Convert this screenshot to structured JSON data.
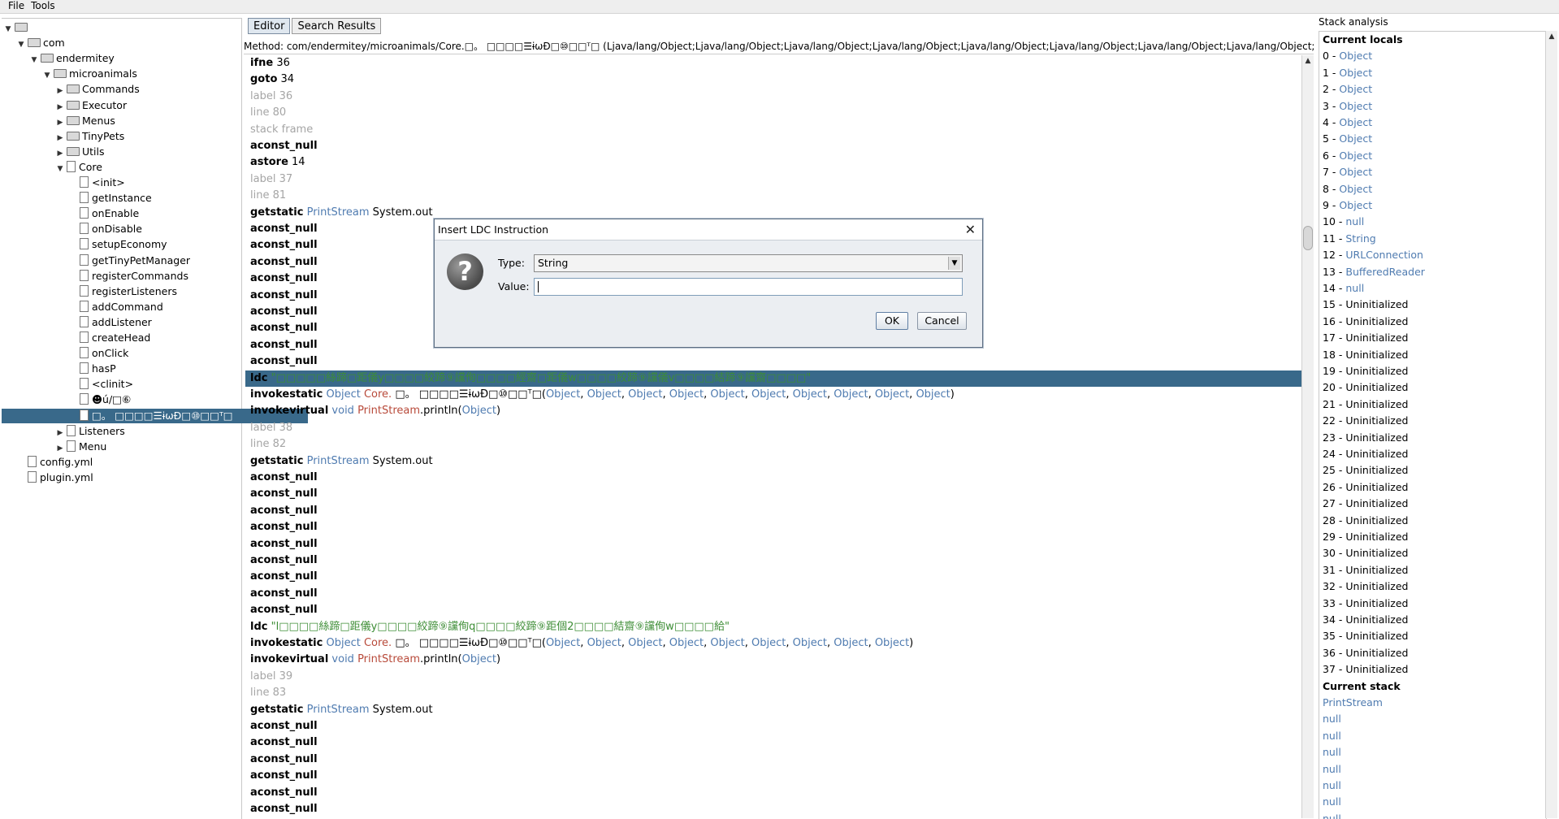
{
  "menu": [
    "File",
    "Tools"
  ],
  "tree": [
    {
      "label": "",
      "depth": 0,
      "kind": "folder",
      "expanded": true
    },
    {
      "label": "com",
      "depth": 1,
      "kind": "folder",
      "expanded": true
    },
    {
      "label": "endermitey",
      "depth": 2,
      "kind": "folder",
      "expanded": true
    },
    {
      "label": "microanimals",
      "depth": 3,
      "kind": "folder",
      "expanded": true
    },
    {
      "label": "Commands",
      "depth": 4,
      "kind": "folder",
      "expanded": false
    },
    {
      "label": "Executor",
      "depth": 4,
      "kind": "folder",
      "expanded": false
    },
    {
      "label": "Menus",
      "depth": 4,
      "kind": "folder",
      "expanded": false
    },
    {
      "label": "TinyPets",
      "depth": 4,
      "kind": "folder",
      "expanded": false
    },
    {
      "label": "Utils",
      "depth": 4,
      "kind": "folder",
      "expanded": false
    },
    {
      "label": "Core",
      "depth": 4,
      "kind": "file",
      "expanded": true
    },
    {
      "label": "<init>",
      "depth": 5,
      "kind": "file"
    },
    {
      "label": "getInstance",
      "depth": 5,
      "kind": "file"
    },
    {
      "label": "onEnable",
      "depth": 5,
      "kind": "file"
    },
    {
      "label": "onDisable",
      "depth": 5,
      "kind": "file"
    },
    {
      "label": "setupEconomy",
      "depth": 5,
      "kind": "file"
    },
    {
      "label": "getTinyPetManager",
      "depth": 5,
      "kind": "file"
    },
    {
      "label": "registerCommands",
      "depth": 5,
      "kind": "file"
    },
    {
      "label": "registerListeners",
      "depth": 5,
      "kind": "file"
    },
    {
      "label": "addCommand",
      "depth": 5,
      "kind": "file"
    },
    {
      "label": "addListener",
      "depth": 5,
      "kind": "file"
    },
    {
      "label": "createHead",
      "depth": 5,
      "kind": "file"
    },
    {
      "label": "onClick",
      "depth": 5,
      "kind": "file"
    },
    {
      "label": "hasP",
      "depth": 5,
      "kind": "file"
    },
    {
      "label": "<clinit>",
      "depth": 5,
      "kind": "file"
    },
    {
      "label": "☻ú/□⑥",
      "depth": 5,
      "kind": "file"
    },
    {
      "label": "□。  □□□□☰ɨωĐ□⑩□□ᵀ□",
      "depth": 5,
      "kind": "file",
      "selected": true
    },
    {
      "label": "Listeners",
      "depth": 4,
      "kind": "file",
      "expanded": false
    },
    {
      "label": "Menu",
      "depth": 4,
      "kind": "file",
      "expanded": false
    },
    {
      "label": "config.yml",
      "depth": 1,
      "kind": "file"
    },
    {
      "label": "plugin.yml",
      "depth": 1,
      "kind": "file"
    }
  ],
  "tabs": [
    "Editor",
    "Search Results"
  ],
  "method_signature": "Method: com/endermitey/microanimals/Core.□。  □□□□☰ɨωĐ□⑩□□ᵀ□ (Ljava/lang/Object;Ljava/lang/Object;Ljava/lang/Object;Ljava/lang/Object;Ljava/lang/Object;Ljava/lang/Object;Ljava/lang/Object;Ljava/lang/Object;Ljava/lang/Object;Ljav...",
  "code_lines": [
    {
      "parts": [
        [
          "op",
          "ifne"
        ],
        [
          "",
          "36"
        ]
      ]
    },
    {
      "parts": [
        [
          "op",
          "goto"
        ],
        [
          "",
          "34"
        ]
      ]
    },
    {
      "parts": [
        [
          "gray",
          "label 36"
        ]
      ]
    },
    {
      "parts": [
        [
          "gray",
          "line 80"
        ]
      ]
    },
    {
      "parts": [
        [
          "gray",
          "stack frame"
        ]
      ]
    },
    {
      "parts": [
        [
          "op",
          "aconst_null"
        ]
      ]
    },
    {
      "parts": [
        [
          "op",
          "astore"
        ],
        [
          "",
          "14"
        ]
      ]
    },
    {
      "parts": [
        [
          "gray",
          "label 37"
        ]
      ]
    },
    {
      "parts": [
        [
          "gray",
          "line 81"
        ]
      ]
    },
    {
      "parts": [
        [
          "op",
          "getstatic"
        ],
        [
          "blue",
          "PrintStream"
        ],
        [
          "",
          " System.out"
        ]
      ]
    },
    {
      "parts": [
        [
          "op",
          "aconst_null"
        ]
      ]
    },
    {
      "parts": [
        [
          "op",
          "aconst_null"
        ]
      ]
    },
    {
      "parts": [
        [
          "op",
          "aconst_null"
        ]
      ]
    },
    {
      "parts": [
        [
          "op",
          "aconst_null"
        ]
      ]
    },
    {
      "parts": [
        [
          "op",
          "aconst_null"
        ]
      ]
    },
    {
      "parts": [
        [
          "op",
          "aconst_null"
        ]
      ]
    },
    {
      "parts": [
        [
          "op",
          "aconst_null"
        ]
      ]
    },
    {
      "parts": [
        [
          "op",
          "aconst_null"
        ]
      ]
    },
    {
      "parts": [
        [
          "op",
          "aconst_null"
        ]
      ]
    },
    {
      "selected": true,
      "parts": [
        [
          "op",
          "ldc"
        ],
        [
          "green",
          "\"□□□□□絲蹄□距儀y□□□□絞蹄⑨讜侚□□□□經齋□距儀w□□□□絞蹄⑨讜儀v□□□□結蹄⑨讜齋□□□□\""
        ]
      ]
    },
    {
      "parts": [
        [
          "op",
          "invokestatic"
        ],
        [
          "blue",
          "Object"
        ],
        [
          "red",
          " Core."
        ],
        [
          "",
          " □。  □□□□☰ɨωĐ□⑩□□ᵀ□("
        ],
        [
          "blue",
          "Object"
        ],
        [
          "",
          ", "
        ],
        [
          "blue",
          "Object"
        ],
        [
          "",
          ", "
        ],
        [
          "blue",
          "Object"
        ],
        [
          "",
          ", "
        ],
        [
          "blue",
          "Object"
        ],
        [
          "",
          ", "
        ],
        [
          "blue",
          "Object"
        ],
        [
          "",
          ", "
        ],
        [
          "blue",
          "Object"
        ],
        [
          "",
          ", "
        ],
        [
          "blue",
          "Object"
        ],
        [
          "",
          ", "
        ],
        [
          "blue",
          "Object"
        ],
        [
          "",
          ", "
        ],
        [
          "blue",
          "Object"
        ],
        [
          "",
          ", "
        ],
        [
          "blue",
          "Object"
        ],
        [
          "",
          ")"
        ]
      ]
    },
    {
      "parts": [
        [
          "op",
          "invokevirtual"
        ],
        [
          "blue",
          "void"
        ],
        [
          "red",
          " PrintStream"
        ],
        [
          "",
          ".println("
        ],
        [
          "blue",
          "Object"
        ],
        [
          "",
          ")"
        ]
      ]
    },
    {
      "parts": [
        [
          "gray",
          "label 38"
        ]
      ]
    },
    {
      "parts": [
        [
          "gray",
          "line 82"
        ]
      ]
    },
    {
      "parts": [
        [
          "op",
          "getstatic"
        ],
        [
          "blue",
          "PrintStream"
        ],
        [
          "",
          " System.out"
        ]
      ]
    },
    {
      "parts": [
        [
          "op",
          "aconst_null"
        ]
      ]
    },
    {
      "parts": [
        [
          "op",
          "aconst_null"
        ]
      ]
    },
    {
      "parts": [
        [
          "op",
          "aconst_null"
        ]
      ]
    },
    {
      "parts": [
        [
          "op",
          "aconst_null"
        ]
      ]
    },
    {
      "parts": [
        [
          "op",
          "aconst_null"
        ]
      ]
    },
    {
      "parts": [
        [
          "op",
          "aconst_null"
        ]
      ]
    },
    {
      "parts": [
        [
          "op",
          "aconst_null"
        ]
      ]
    },
    {
      "parts": [
        [
          "op",
          "aconst_null"
        ]
      ]
    },
    {
      "parts": [
        [
          "op",
          "aconst_null"
        ]
      ]
    },
    {
      "parts": [
        [
          "op",
          "ldc"
        ],
        [
          "green",
          "\"l□□□□絲蹄□距儀y□□□□絞蹄⑨讜侚q□□□□絞蹄⑨距個2□□□□結齋⑨讜侚w□□□□給\""
        ]
      ]
    },
    {
      "parts": [
        [
          "op",
          "invokestatic"
        ],
        [
          "blue",
          "Object"
        ],
        [
          "red",
          " Core."
        ],
        [
          "",
          " □。  □□□□☰ɨωĐ□⑩□□ᵀ□("
        ],
        [
          "blue",
          "Object"
        ],
        [
          "",
          ", "
        ],
        [
          "blue",
          "Object"
        ],
        [
          "",
          ", "
        ],
        [
          "blue",
          "Object"
        ],
        [
          "",
          ", "
        ],
        [
          "blue",
          "Object"
        ],
        [
          "",
          ", "
        ],
        [
          "blue",
          "Object"
        ],
        [
          "",
          ", "
        ],
        [
          "blue",
          "Object"
        ],
        [
          "",
          ", "
        ],
        [
          "blue",
          "Object"
        ],
        [
          "",
          ", "
        ],
        [
          "blue",
          "Object"
        ],
        [
          "",
          ", "
        ],
        [
          "blue",
          "Object"
        ],
        [
          "",
          ")"
        ]
      ]
    },
    {
      "parts": [
        [
          "op",
          "invokevirtual"
        ],
        [
          "blue",
          "void"
        ],
        [
          "red",
          " PrintStream"
        ],
        [
          "",
          ".println("
        ],
        [
          "blue",
          "Object"
        ],
        [
          "",
          ")"
        ]
      ]
    },
    {
      "parts": [
        [
          "gray",
          "label 39"
        ]
      ]
    },
    {
      "parts": [
        [
          "gray",
          "line 83"
        ]
      ]
    },
    {
      "parts": [
        [
          "op",
          "getstatic"
        ],
        [
          "blue",
          "PrintStream"
        ],
        [
          "",
          " System.out"
        ]
      ]
    },
    {
      "parts": [
        [
          "op",
          "aconst_null"
        ]
      ]
    },
    {
      "parts": [
        [
          "op",
          "aconst_null"
        ]
      ]
    },
    {
      "parts": [
        [
          "op",
          "aconst_null"
        ]
      ]
    },
    {
      "parts": [
        [
          "op",
          "aconst_null"
        ]
      ]
    },
    {
      "parts": [
        [
          "op",
          "aconst_null"
        ]
      ]
    },
    {
      "parts": [
        [
          "op",
          "aconst_null"
        ]
      ]
    },
    {
      "parts": [
        [
          "op",
          "aconst_null"
        ]
      ]
    }
  ],
  "stack_analysis": {
    "title": "Stack analysis",
    "locals_header": "Current locals",
    "locals": [
      [
        "0",
        "Object",
        "blue"
      ],
      [
        "1",
        "Object",
        "blue"
      ],
      [
        "2",
        "Object",
        "blue"
      ],
      [
        "3",
        "Object",
        "blue"
      ],
      [
        "4",
        "Object",
        "blue"
      ],
      [
        "5",
        "Object",
        "blue"
      ],
      [
        "6",
        "Object",
        "blue"
      ],
      [
        "7",
        "Object",
        "blue"
      ],
      [
        "8",
        "Object",
        "blue"
      ],
      [
        "9",
        "Object",
        "blue"
      ],
      [
        "10",
        "null",
        "blue"
      ],
      [
        "11",
        "String",
        "blue"
      ],
      [
        "12",
        "URLConnection",
        "blue"
      ],
      [
        "13",
        "BufferedReader",
        "blue"
      ],
      [
        "14",
        "null",
        "blue"
      ],
      [
        "15",
        "Uninitialized",
        ""
      ],
      [
        "16",
        "Uninitialized",
        ""
      ],
      [
        "17",
        "Uninitialized",
        ""
      ],
      [
        "18",
        "Uninitialized",
        ""
      ],
      [
        "19",
        "Uninitialized",
        ""
      ],
      [
        "20",
        "Uninitialized",
        ""
      ],
      [
        "21",
        "Uninitialized",
        ""
      ],
      [
        "22",
        "Uninitialized",
        ""
      ],
      [
        "23",
        "Uninitialized",
        ""
      ],
      [
        "24",
        "Uninitialized",
        ""
      ],
      [
        "25",
        "Uninitialized",
        ""
      ],
      [
        "26",
        "Uninitialized",
        ""
      ],
      [
        "27",
        "Uninitialized",
        ""
      ],
      [
        "28",
        "Uninitialized",
        ""
      ],
      [
        "29",
        "Uninitialized",
        ""
      ],
      [
        "30",
        "Uninitialized",
        ""
      ],
      [
        "31",
        "Uninitialized",
        ""
      ],
      [
        "32",
        "Uninitialized",
        ""
      ],
      [
        "33",
        "Uninitialized",
        ""
      ],
      [
        "34",
        "Uninitialized",
        ""
      ],
      [
        "35",
        "Uninitialized",
        ""
      ],
      [
        "36",
        "Uninitialized",
        ""
      ],
      [
        "37",
        "Uninitialized",
        ""
      ]
    ],
    "stack_header": "Current stack",
    "stack": [
      "PrintStream",
      "null",
      "null",
      "null",
      "null",
      "null",
      "null",
      "null"
    ]
  },
  "dialog": {
    "title": "Insert LDC Instruction",
    "close_glyph": "✕",
    "icon_glyph": "?",
    "type_label": "Type:",
    "type_value": "String",
    "value_label": "Value:",
    "value_text": "",
    "ok_label": "OK",
    "cancel_label": "Cancel"
  }
}
